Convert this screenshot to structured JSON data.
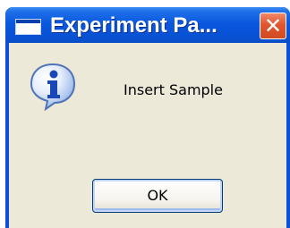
{
  "window": {
    "title": "Experiment Pa...",
    "close_label": "✕"
  },
  "dialog": {
    "icon": "information-icon",
    "message": "Insert Sample",
    "ok_label": "OK"
  },
  "colors": {
    "titlebar": "#0a58de",
    "client_background": "#ece9d8",
    "close_button": "#e0562e",
    "button_border": "#003c74"
  }
}
